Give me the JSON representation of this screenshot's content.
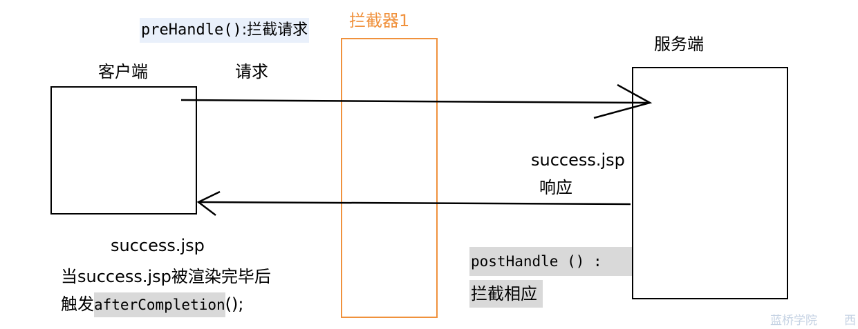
{
  "pre_handle": {
    "code": "preHandle()",
    "text": ":拦截请求"
  },
  "interceptor": {
    "label": "拦截器1",
    "color": "#f0913c"
  },
  "client": {
    "label": "客户端"
  },
  "server": {
    "label": "服务端"
  },
  "request_label": "请求",
  "response": {
    "line1": "success.jsp",
    "line2": "响应"
  },
  "post_handle": {
    "code": "postHandle () :",
    "text": "拦截相应"
  },
  "after": {
    "line1": "success.jsp",
    "line2": "当success.jsp被渲染完毕后",
    "line3_prefix": "触发",
    "line3_code": "afterCompletion",
    "line3_suffix": "();"
  },
  "watermark": {
    "text": "蓝桥学院",
    "corner": "西"
  }
}
